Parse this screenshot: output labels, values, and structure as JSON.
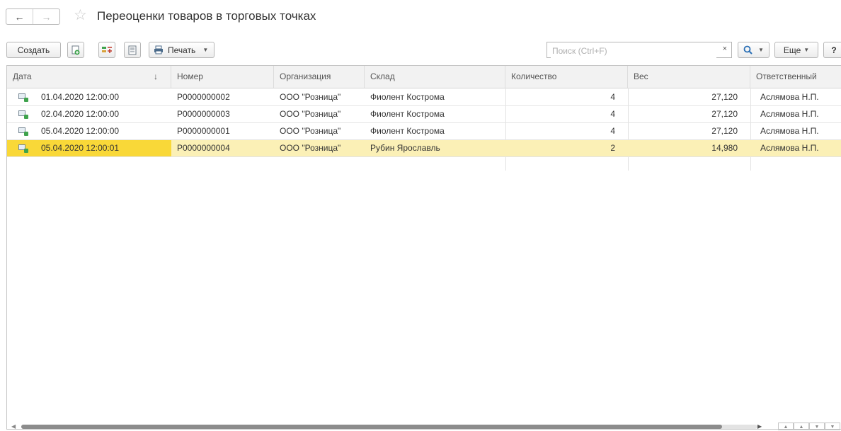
{
  "window": {
    "title": "Переоценки товаров в торговых точках"
  },
  "toolbar": {
    "create_label": "Создать",
    "print_label": "Печать",
    "search_placeholder": "Поиск (Ctrl+F)",
    "search_value": "",
    "clear_symbol": "×",
    "more_label": "Еще",
    "help_label": "?"
  },
  "table": {
    "columns": [
      "Дата",
      "Номер",
      "Организация",
      "Склад",
      "Количество",
      "Вес",
      "Ответственный"
    ],
    "sort_indicator": "↓",
    "rows": [
      {
        "date": "01.04.2020 12:00:00",
        "number": "Р0000000002",
        "org": "ООО \"Розница\"",
        "warehouse": "Фиолент Кострома",
        "qty": "4",
        "weight": "27,120",
        "responsible": "Аслямова Н.П."
      },
      {
        "date": "02.04.2020 12:00:00",
        "number": "Р0000000003",
        "org": "ООО \"Розница\"",
        "warehouse": "Фиолент Кострома",
        "qty": "4",
        "weight": "27,120",
        "responsible": "Аслямова Н.П."
      },
      {
        "date": "05.04.2020 12:00:00",
        "number": "Р0000000001",
        "org": "ООО \"Розница\"",
        "warehouse": "Фиолент Кострома",
        "qty": "4",
        "weight": "27,120",
        "responsible": "Аслямова Н.П."
      },
      {
        "date": "05.04.2020 12:00:01",
        "number": "Р0000000004",
        "org": "ООО \"Розница\"",
        "warehouse": "Рубин Ярославль",
        "qty": "2",
        "weight": "14,980",
        "responsible": "Аслямова Н.П."
      }
    ],
    "selected_row": 3
  },
  "colors": {
    "selected_row": "#fbf0b6",
    "active_cell": "#f9d838",
    "header_bg": "#f2f2f2"
  },
  "icons": [
    "back-arrow-icon",
    "forward-arrow-icon",
    "favorite-star-icon",
    "create-copy-icon",
    "post-documents-icon",
    "report-icon",
    "printer-icon",
    "search-icon",
    "document-icon"
  ]
}
